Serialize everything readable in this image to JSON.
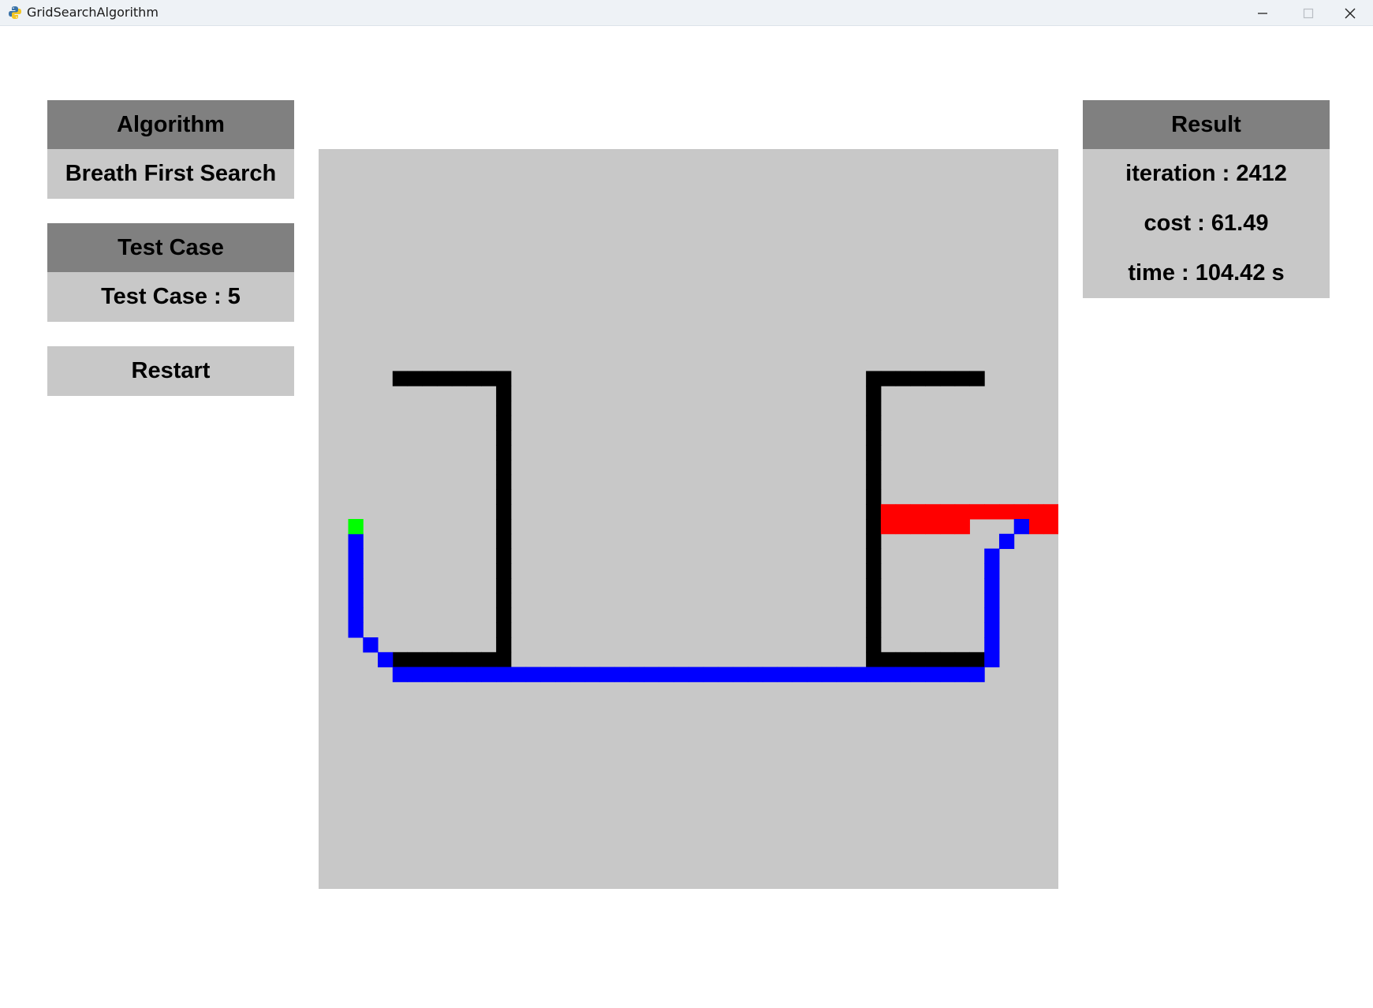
{
  "window": {
    "title": "GridSearchAlgorithm",
    "icons": [
      "python-app-icon",
      "minimize-icon",
      "maximize-icon",
      "close-icon"
    ]
  },
  "algorithm_panel": {
    "header": "Algorithm",
    "value": "Breath First Search"
  },
  "test_case_panel": {
    "header": "Test Case",
    "value": "Test Case : 5"
  },
  "restart_label": "Restart",
  "result_panel": {
    "header": "Result",
    "iteration": "iteration : 2412",
    "cost": "cost : 61.49",
    "time": "time : 104.42 s"
  },
  "grid": {
    "colors": {
      "background": "#c8c8c8",
      "wall": "#000000",
      "path": "#0000ff",
      "start": "#00ff00",
      "goal": "#ff0000"
    },
    "columns": 50,
    "rows": 50,
    "start": [
      2,
      25
    ],
    "goal_cells": [
      [
        38,
        24
      ],
      [
        39,
        24
      ],
      [
        40,
        24
      ],
      [
        41,
        24
      ],
      [
        42,
        24
      ],
      [
        43,
        24
      ],
      [
        44,
        24
      ],
      [
        45,
        24
      ],
      [
        46,
        24
      ],
      [
        47,
        24
      ],
      [
        48,
        24
      ],
      [
        49,
        24
      ],
      [
        38,
        25
      ],
      [
        39,
        25
      ],
      [
        40,
        25
      ],
      [
        41,
        25
      ],
      [
        42,
        25
      ],
      [
        43,
        25
      ],
      [
        48,
        25
      ],
      [
        49,
        25
      ]
    ],
    "walls": [
      [
        5,
        15
      ],
      [
        6,
        15
      ],
      [
        7,
        15
      ],
      [
        8,
        15
      ],
      [
        9,
        15
      ],
      [
        10,
        15
      ],
      [
        11,
        15
      ],
      [
        12,
        15
      ],
      [
        12,
        16
      ],
      [
        12,
        17
      ],
      [
        12,
        18
      ],
      [
        12,
        19
      ],
      [
        12,
        20
      ],
      [
        12,
        21
      ],
      [
        12,
        22
      ],
      [
        12,
        23
      ],
      [
        12,
        24
      ],
      [
        12,
        25
      ],
      [
        12,
        26
      ],
      [
        12,
        27
      ],
      [
        12,
        28
      ],
      [
        12,
        29
      ],
      [
        12,
        30
      ],
      [
        12,
        31
      ],
      [
        12,
        32
      ],
      [
        12,
        33
      ],
      [
        12,
        34
      ],
      [
        5,
        34
      ],
      [
        6,
        34
      ],
      [
        7,
        34
      ],
      [
        8,
        34
      ],
      [
        9,
        34
      ],
      [
        10,
        34
      ],
      [
        11,
        34
      ],
      [
        37,
        15
      ],
      [
        38,
        15
      ],
      [
        39,
        15
      ],
      [
        40,
        15
      ],
      [
        41,
        15
      ],
      [
        42,
        15
      ],
      [
        43,
        15
      ],
      [
        44,
        15
      ],
      [
        37,
        16
      ],
      [
        37,
        17
      ],
      [
        37,
        18
      ],
      [
        37,
        19
      ],
      [
        37,
        20
      ],
      [
        37,
        21
      ],
      [
        37,
        22
      ],
      [
        37,
        23
      ],
      [
        37,
        24
      ],
      [
        37,
        25
      ],
      [
        37,
        26
      ],
      [
        37,
        27
      ],
      [
        37,
        28
      ],
      [
        37,
        29
      ],
      [
        37,
        30
      ],
      [
        37,
        31
      ],
      [
        37,
        32
      ],
      [
        37,
        33
      ],
      [
        37,
        34
      ],
      [
        38,
        34
      ],
      [
        39,
        34
      ],
      [
        40,
        34
      ],
      [
        41,
        34
      ],
      [
        42,
        34
      ],
      [
        43,
        34
      ],
      [
        44,
        34
      ]
    ],
    "path": [
      [
        2,
        26
      ],
      [
        2,
        27
      ],
      [
        2,
        28
      ],
      [
        2,
        29
      ],
      [
        2,
        30
      ],
      [
        2,
        31
      ],
      [
        2,
        32
      ],
      [
        3,
        33
      ],
      [
        4,
        34
      ],
      [
        5,
        35
      ],
      [
        6,
        35
      ],
      [
        7,
        35
      ],
      [
        8,
        35
      ],
      [
        9,
        35
      ],
      [
        10,
        35
      ],
      [
        11,
        35
      ],
      [
        12,
        35
      ],
      [
        13,
        35
      ],
      [
        14,
        35
      ],
      [
        15,
        35
      ],
      [
        16,
        35
      ],
      [
        17,
        35
      ],
      [
        18,
        35
      ],
      [
        19,
        35
      ],
      [
        20,
        35
      ],
      [
        21,
        35
      ],
      [
        22,
        35
      ],
      [
        23,
        35
      ],
      [
        24,
        35
      ],
      [
        25,
        35
      ],
      [
        26,
        35
      ],
      [
        27,
        35
      ],
      [
        28,
        35
      ],
      [
        29,
        35
      ],
      [
        30,
        35
      ],
      [
        31,
        35
      ],
      [
        32,
        35
      ],
      [
        33,
        35
      ],
      [
        34,
        35
      ],
      [
        35,
        35
      ],
      [
        36,
        35
      ],
      [
        37,
        35
      ],
      [
        38,
        35
      ],
      [
        39,
        35
      ],
      [
        40,
        35
      ],
      [
        41,
        35
      ],
      [
        42,
        35
      ],
      [
        43,
        35
      ],
      [
        44,
        35
      ],
      [
        45,
        34
      ],
      [
        45,
        33
      ],
      [
        45,
        32
      ],
      [
        45,
        31
      ],
      [
        45,
        30
      ],
      [
        45,
        29
      ],
      [
        45,
        28
      ],
      [
        45,
        27
      ],
      [
        46,
        26
      ],
      [
        47,
        25
      ]
    ]
  }
}
